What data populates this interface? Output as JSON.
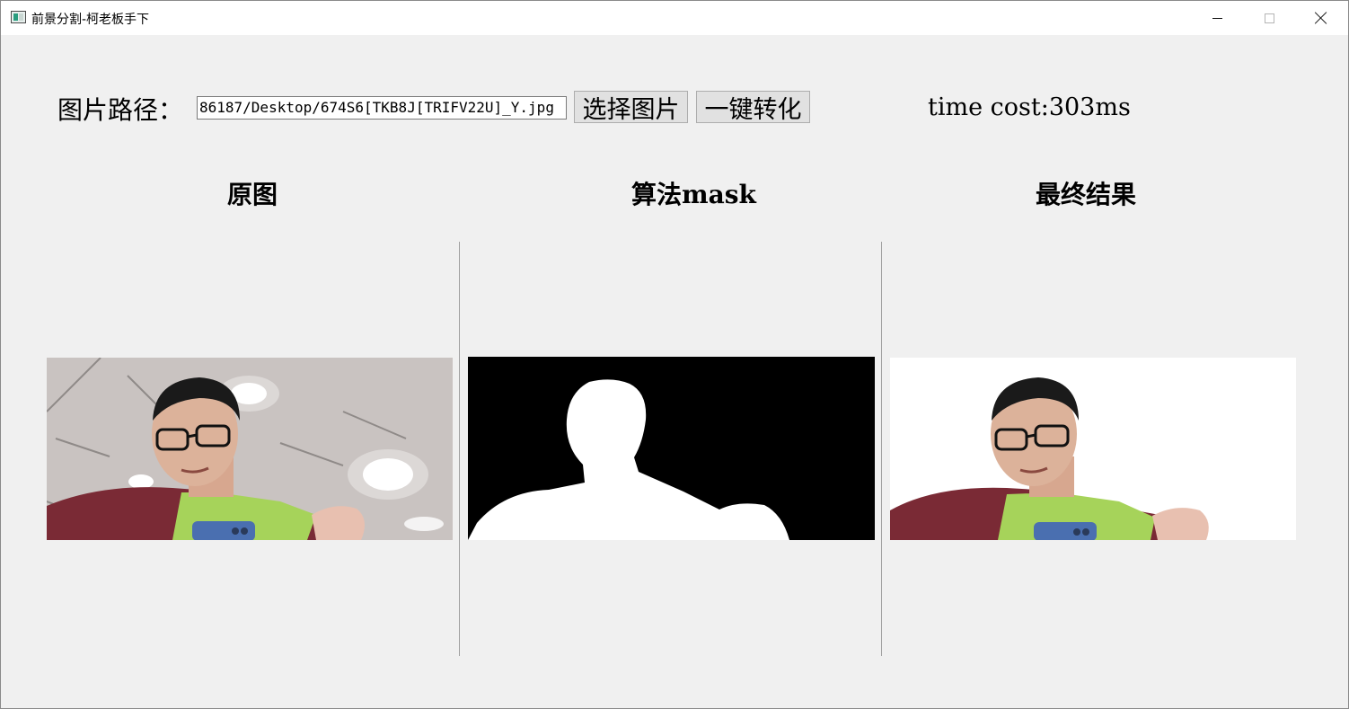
{
  "window": {
    "title": "前景分割-柯老板手下"
  },
  "toolbar": {
    "path_label": "图片路径：",
    "path_value": "86187/Desktop/674S6[TKB8J[TRIFV22U]_Y.jpg",
    "select_button": "选择图片",
    "convert_button": "一键转化",
    "time_cost": "time cost:303ms"
  },
  "columns": [
    {
      "title": "原图"
    },
    {
      "title": "算法mask"
    },
    {
      "title": "最终结果"
    }
  ],
  "colors": {
    "window_bg": "#f0f0f0",
    "titlebar_bg": "#ffffff",
    "mask_bg": "#000000",
    "mask_fg": "#ffffff",
    "jacket": "#7a2a35",
    "vest": "#a6d35a",
    "phone": "#4a6fb0"
  }
}
